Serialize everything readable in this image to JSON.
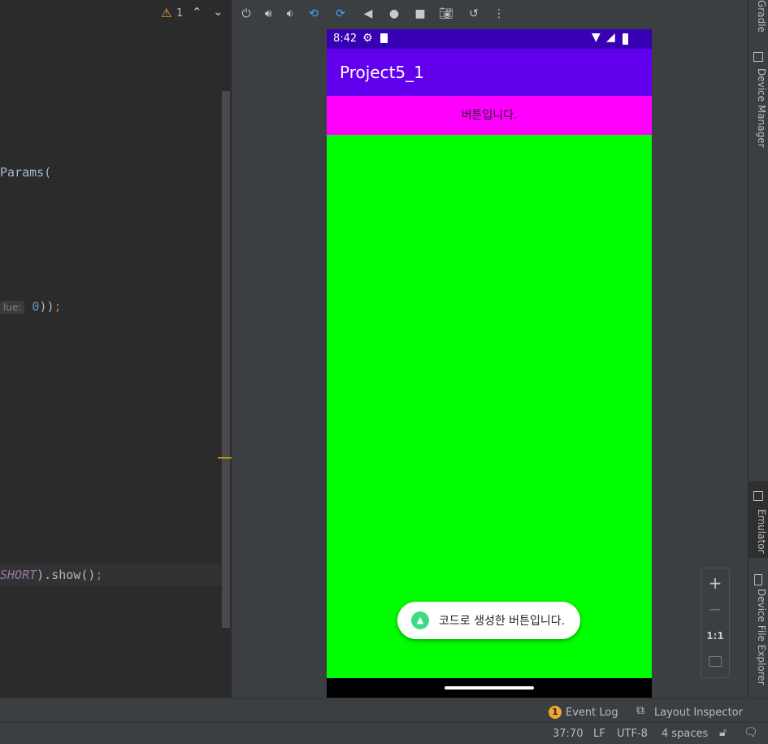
{
  "editor": {
    "warning_count": "1",
    "line_params": "Params(",
    "line_value_hint": "lue:",
    "line_value_num": "0",
    "line_value_close": "))",
    "line_value_semi": ";",
    "line_short": "SHORT",
    "line_show": ").show()",
    "line_show_semi": ";"
  },
  "phone": {
    "time": "8:42",
    "app_title": "Project5_1",
    "button_label": "버튼입니다.",
    "toast_text": "코드로 생성한 버튼입니다."
  },
  "zoom": {
    "plus": "+",
    "minus": "−",
    "one_to_one": "1:1"
  },
  "right_tabs": {
    "gradle": "Gradle",
    "device_manager": "Device Manager",
    "emulator": "Emulator",
    "device_file_explorer": "Device File Explorer"
  },
  "bottom_tools": {
    "event_log_badge": "1",
    "event_log": "Event Log",
    "layout_inspector": "Layout Inspector"
  },
  "status": {
    "position": "37:70",
    "line_sep": "LF",
    "encoding": "UTF-8",
    "indent": "4 spaces"
  },
  "colors": {
    "status_bar": "#3700b3",
    "app_bar": "#6200ee",
    "button_bg": "#ff00ff",
    "layout_bg": "#00ff00",
    "warning": "#f0a732"
  }
}
